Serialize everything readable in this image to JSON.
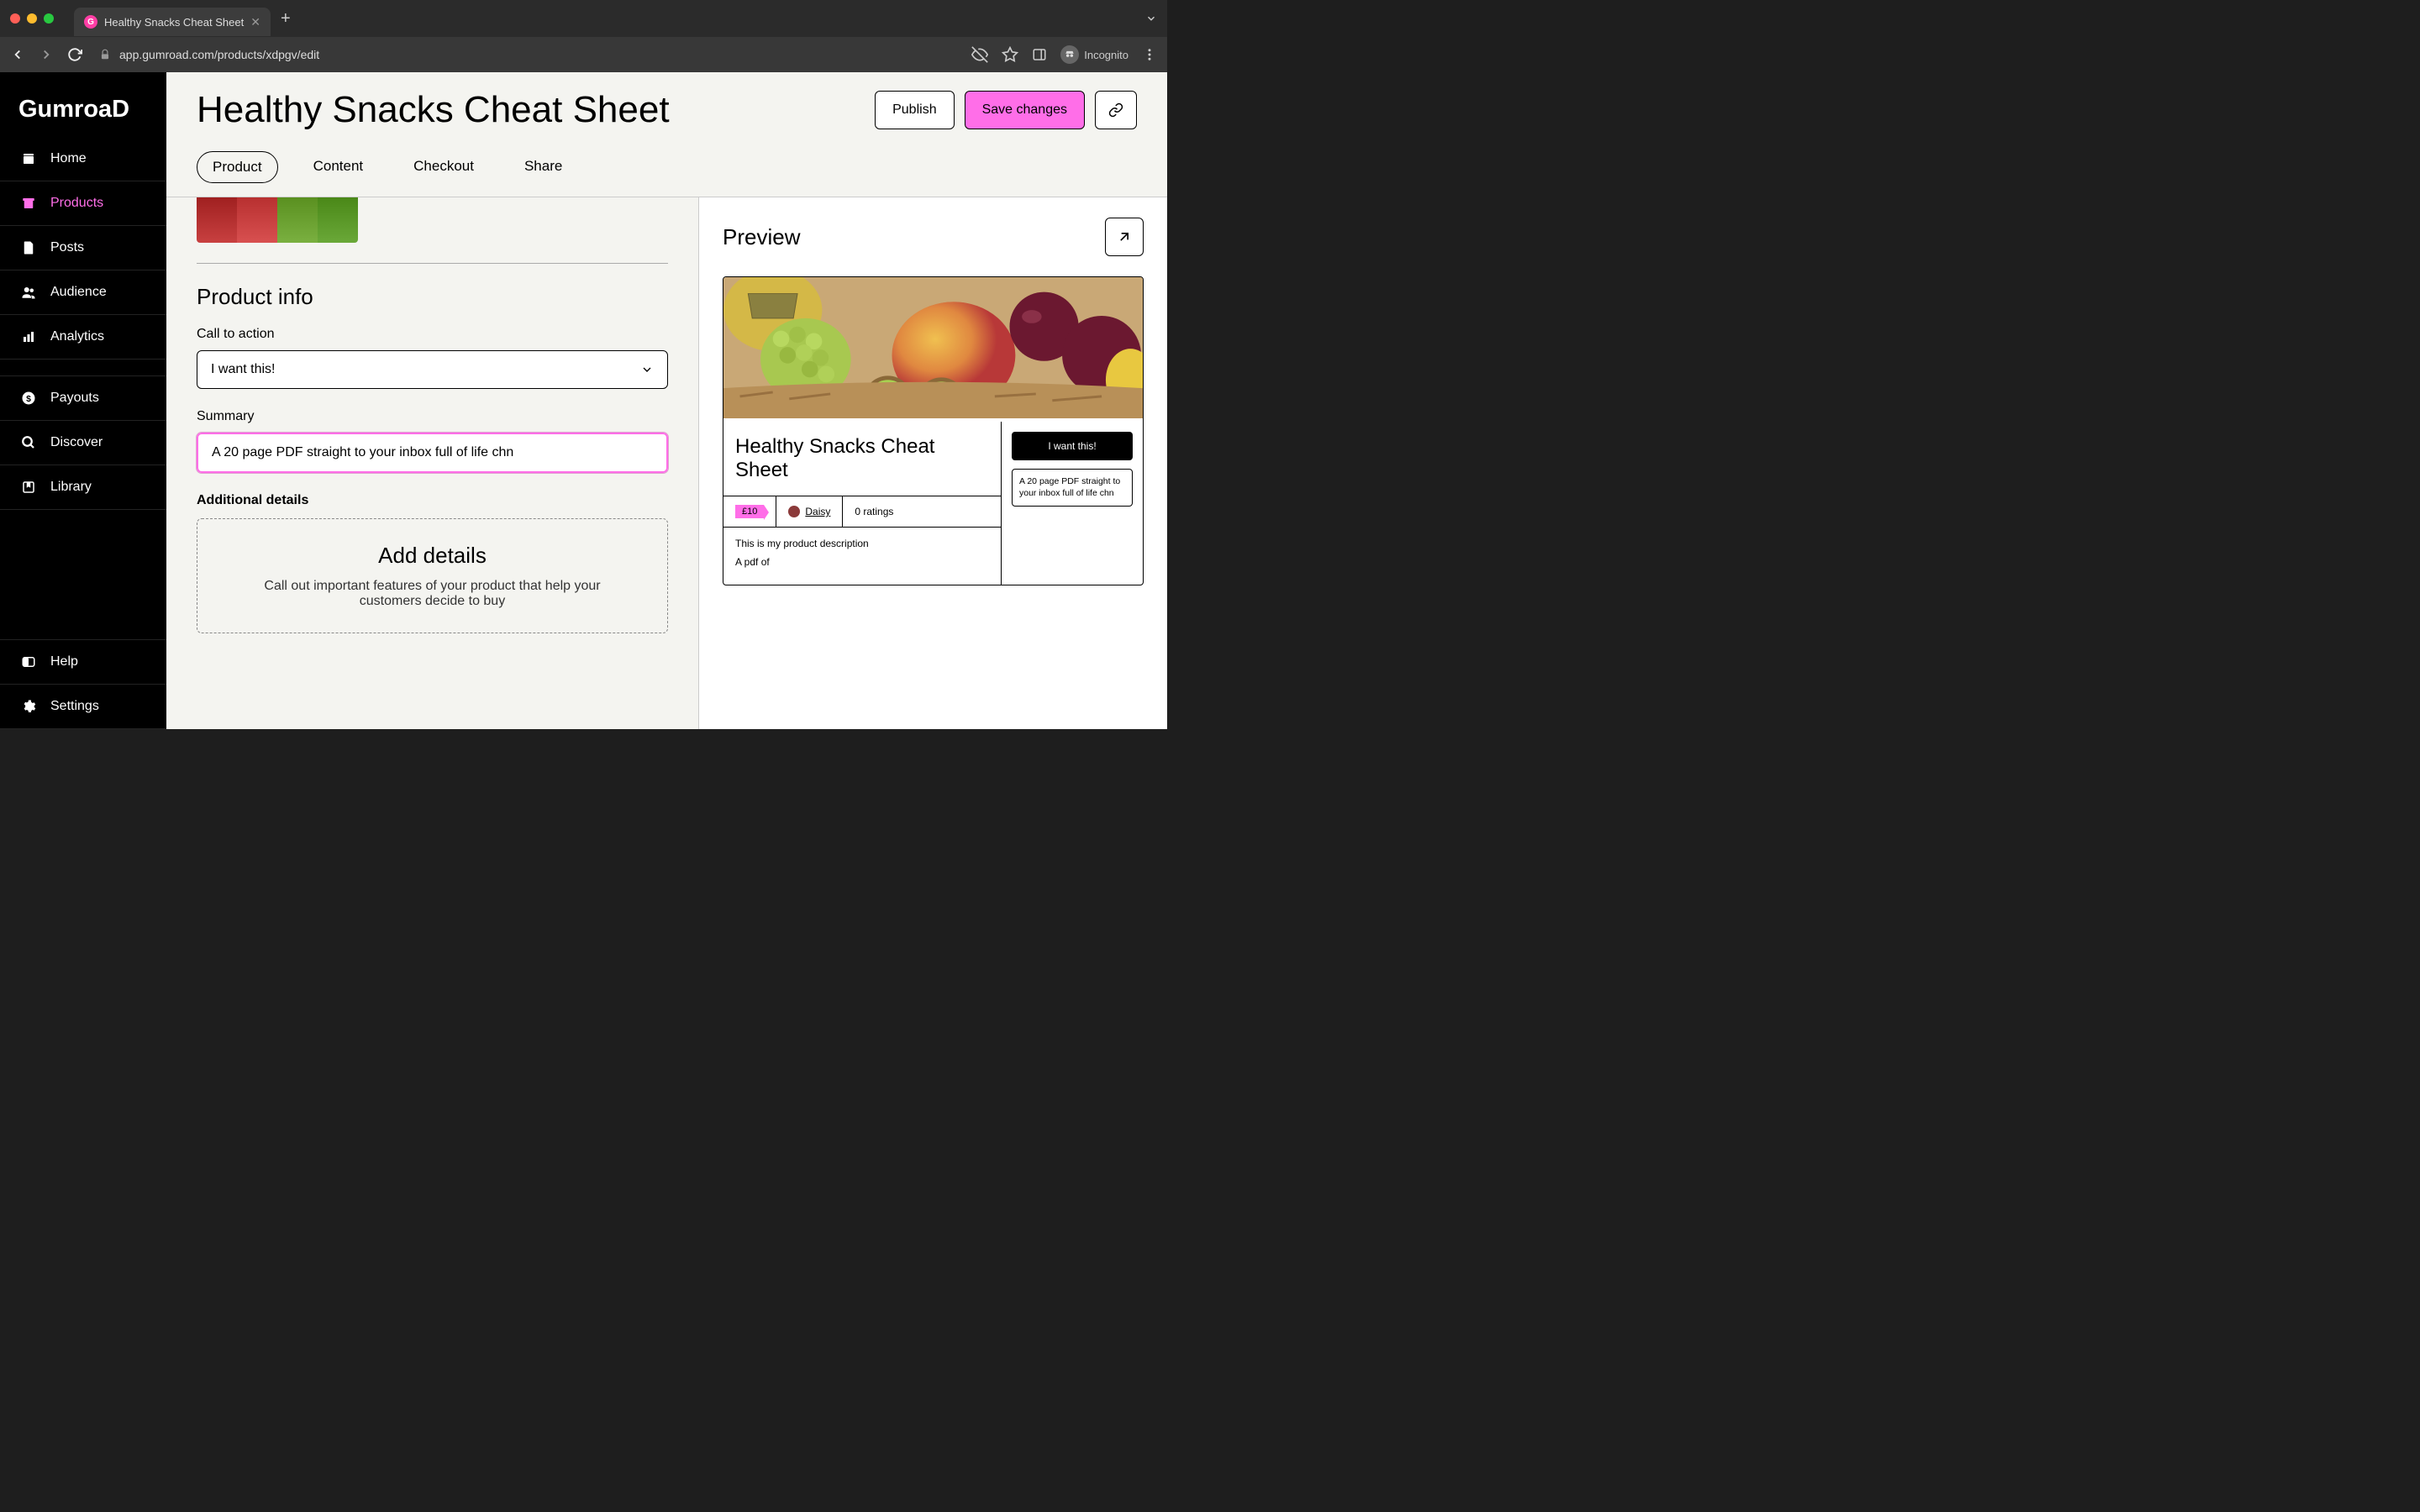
{
  "browser": {
    "tab_title": "Healthy Snacks Cheat Sheet",
    "url": "app.gumroad.com/products/xdpgv/edit",
    "incognito_label": "Incognito"
  },
  "sidebar": {
    "logo": "GumroaD",
    "items": [
      {
        "label": "Home",
        "icon": "home"
      },
      {
        "label": "Products",
        "icon": "archive",
        "active": true
      },
      {
        "label": "Posts",
        "icon": "file"
      },
      {
        "label": "Audience",
        "icon": "users"
      },
      {
        "label": "Analytics",
        "icon": "bars"
      }
    ],
    "bottom_items": [
      {
        "label": "Payouts",
        "icon": "dollar"
      },
      {
        "label": "Discover",
        "icon": "search"
      },
      {
        "label": "Library",
        "icon": "bookmark"
      }
    ],
    "footer_items": [
      {
        "label": "Help",
        "icon": "help"
      },
      {
        "label": "Settings",
        "icon": "gear"
      }
    ]
  },
  "header": {
    "title": "Healthy Snacks Cheat Sheet",
    "publish": "Publish",
    "save": "Save changes"
  },
  "tabs": [
    "Product",
    "Content",
    "Checkout",
    "Share"
  ],
  "editor": {
    "section_title": "Product info",
    "cta_label": "Call to action",
    "cta_value": "I want this!",
    "summary_label": "Summary",
    "summary_value": "A 20 page PDF straight to your inbox full of life chn",
    "details_label": "Additional details",
    "details_heading": "Add details",
    "details_sub": "Call out important features of your product that help your customers decide to buy"
  },
  "preview": {
    "heading": "Preview",
    "product_title": "Healthy Snacks Cheat Sheet",
    "price": "£10",
    "author": "Daisy",
    "ratings": "0 ratings",
    "desc1": "This is my product description",
    "desc2": "A pdf of",
    "cta": "I want this!",
    "summary": "A 20 page PDF straight to your inbox full of life chn"
  }
}
